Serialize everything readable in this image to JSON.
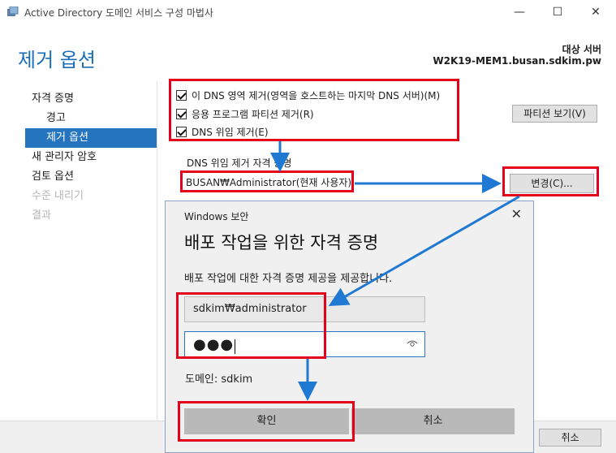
{
  "window": {
    "title": "Active Directory 도메인 서비스 구성 마법사",
    "minimize": "—",
    "maximize": "☐",
    "close": "✕"
  },
  "header": {
    "page_title": "제거 옵션",
    "target_label": "대상 서버",
    "target_server": "W2K19-MEM1.busan.sdkim.pw"
  },
  "nav": {
    "items": [
      {
        "label": "자격 증명"
      },
      {
        "label": "경고"
      },
      {
        "label": "제거 옵션"
      },
      {
        "label": "새 관리자 암호"
      },
      {
        "label": "검토 옵션"
      },
      {
        "label": "수준 내리기"
      },
      {
        "label": "결과"
      }
    ]
  },
  "options": {
    "remove_dns_zone": "이 DNS 영역 제거(영역을 호스트하는 마지막 DNS 서버)(M)",
    "remove_app_partitions": "응용 프로그램 파티션 제거(R)",
    "remove_dns_delegation": "DNS 위임 제거(E)",
    "view_partitions_button": "파티션 보기(V)",
    "dns_cred_label": "DNS 위임 제거 자격 증명",
    "dns_cred_value": "BUSAN₩Administrator(현재 사용자)",
    "change_button": "변경(C)..."
  },
  "footer": {
    "cancel": "취소"
  },
  "dialog": {
    "title": "Windows 보안",
    "close": "✕",
    "heading": "배포 작업을 위한 자격 증명",
    "description": "배포 작업에 대한 자격 증명 제공을 제공합니다.",
    "username_value": "sdkim₩administrator",
    "password_mask": "●●●",
    "domain_line": "도메인: sdkim",
    "ok_button": "확인",
    "cancel_button": "취소"
  },
  "colors": {
    "accent": "#1a6db8",
    "nav_active": "#2474c0",
    "highlight_box": "#e3001b",
    "arrow": "#1f78d1"
  }
}
